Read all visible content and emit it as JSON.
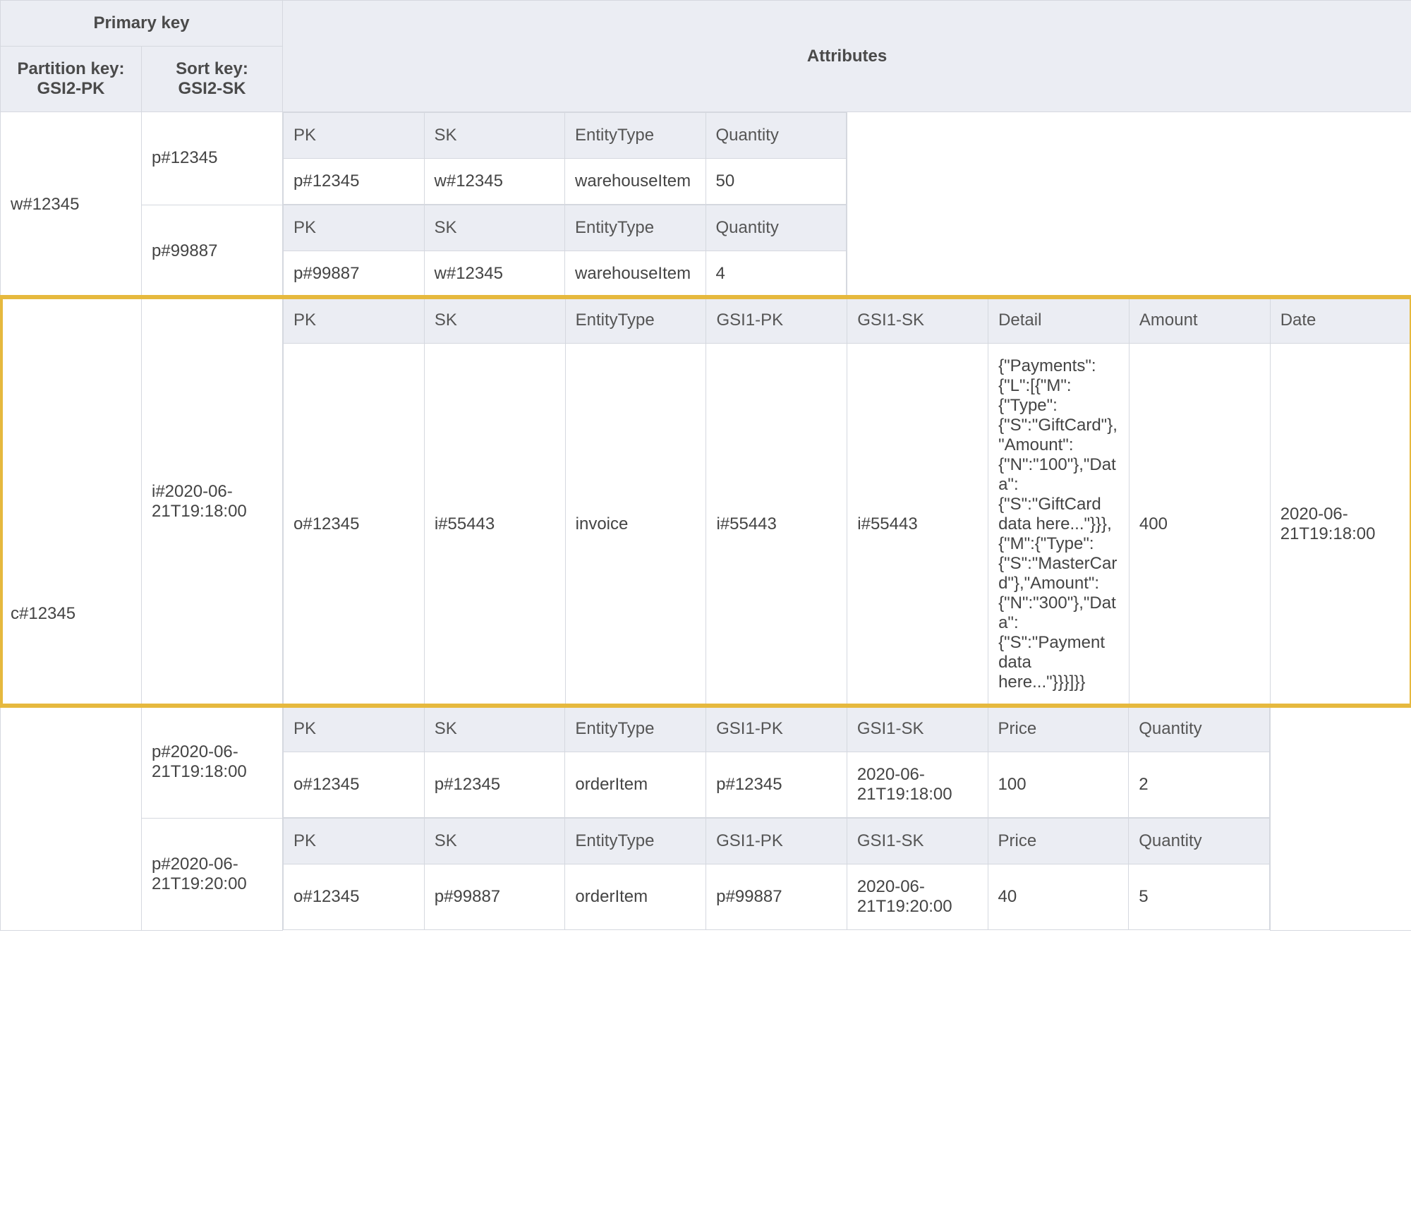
{
  "header": {
    "primary_key": "Primary key",
    "partition_key": "Partition key: GSI2-PK",
    "sort_key": "Sort key: GSI2-SK",
    "attributes": "Attributes"
  },
  "cols": {
    "pk": "PK",
    "sk": "SK",
    "entity_type": "EntityType",
    "quantity": "Quantity",
    "gsi1_pk": "GSI1-PK",
    "gsi1_sk": "GSI1-SK",
    "detail": "Detail",
    "amount": "Amount",
    "date": "Date",
    "price": "Price"
  },
  "rows": {
    "g1": {
      "partition": "w#12345",
      "items": [
        {
          "sort": "p#12345",
          "attrs": {
            "pk": "p#12345",
            "sk": "w#12345",
            "entity_type": "warehouseItem",
            "quantity": "50"
          }
        },
        {
          "sort": "p#99887",
          "attrs": {
            "pk": "p#99887",
            "sk": "w#12345",
            "entity_type": "warehouseItem",
            "quantity": "4"
          }
        }
      ]
    },
    "g2": {
      "partition": "c#12345",
      "items": [
        {
          "sort": "i#2020-06-21T19:18:00",
          "attrs": {
            "pk": "o#12345",
            "sk": "i#55443",
            "entity_type": "invoice",
            "gsi1_pk": "i#55443",
            "gsi1_sk": "i#55443",
            "detail": "{\"Payments\":{\"L\":[{\"M\":{\"Type\":{\"S\":\"GiftCard\"},\"Amount\":{\"N\":\"100\"},\"Data\":{\"S\":\"GiftCard data here...\"}}},{\"M\":{\"Type\":{\"S\":\"MasterCard\"},\"Amount\":{\"N\":\"300\"},\"Data\":{\"S\":\"Payment data here...\"}}}]}}",
            "amount": "400",
            "date": "2020-06-21T19:18:00"
          }
        },
        {
          "sort": "p#2020-06-21T19:18:00",
          "attrs": {
            "pk": "o#12345",
            "sk": "p#12345",
            "entity_type": "orderItem",
            "gsi1_pk": "p#12345",
            "gsi1_sk": "2020-06-21T19:18:00",
            "price": "100",
            "quantity": "2"
          }
        },
        {
          "sort": "p#2020-06-21T19:20:00",
          "attrs": {
            "pk": "o#12345",
            "sk": "p#99887",
            "entity_type": "orderItem",
            "gsi1_pk": "p#99887",
            "gsi1_sk": "2020-06-21T19:20:00",
            "price": "40",
            "quantity": "5"
          }
        }
      ]
    }
  }
}
